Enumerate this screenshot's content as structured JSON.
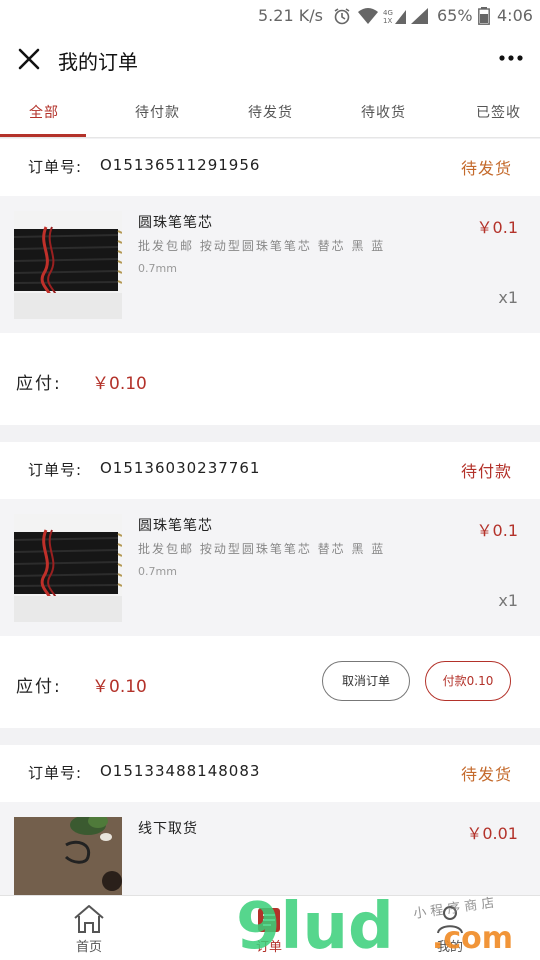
{
  "status_bar": {
    "speed": "5.21 K/s",
    "battery": "65%",
    "time": "4:06"
  },
  "header": {
    "title": "我的订单"
  },
  "tabs": [
    {
      "label": "全部",
      "active": true
    },
    {
      "label": "待付款"
    },
    {
      "label": "待发货"
    },
    {
      "label": "待收货"
    },
    {
      "label": "已签收"
    }
  ],
  "labels": {
    "order_no": "订单号:",
    "payable": "应付:"
  },
  "orders": [
    {
      "order_no": "O15136511291956",
      "status": "待发货",
      "item": {
        "name": "圆珠笔笔芯",
        "desc": "批发包邮 按动型圆珠笔笔芯 替芯 黑 蓝",
        "spec": "0.7mm",
        "price": "￥0.1",
        "qty": "x1",
        "image": "pen-refills"
      },
      "payable": "￥0.10"
    },
    {
      "order_no": "O15136030237761",
      "status": "待付款",
      "item": {
        "name": "圆珠笔笔芯",
        "desc": "批发包邮 按动型圆珠笔笔芯 替芯 黑 蓝",
        "spec": "0.7mm",
        "price": "￥0.1",
        "qty": "x1",
        "image": "pen-refills"
      },
      "payable": "￥0.10",
      "buttons": {
        "cancel": "取消订单",
        "pay": "付款0.10"
      }
    },
    {
      "order_no": "O15133488148083",
      "status": "待发货",
      "item": {
        "name": "线下取货",
        "price": "￥0.01",
        "image": "desk-photo"
      }
    }
  ],
  "bottom_nav": [
    {
      "label": "首页",
      "icon": "home-icon"
    },
    {
      "label": "订单",
      "icon": "orders-icon",
      "active": true
    },
    {
      "label": "我的",
      "icon": "user-icon"
    }
  ],
  "watermark": {
    "brand": "9lud.com",
    "caption": "小程序商店"
  },
  "colors": {
    "accent": "#b3322a",
    "status_orange": "#c46a2c"
  }
}
